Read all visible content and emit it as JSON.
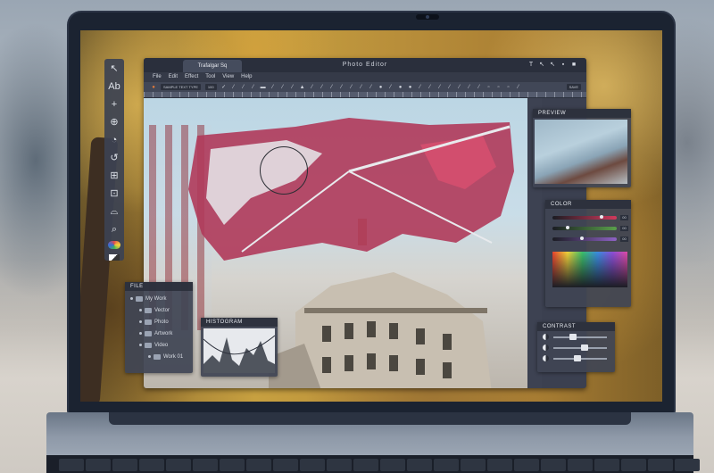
{
  "window": {
    "title": "Photo Editor",
    "document_tab": "Trafalgar Sq",
    "controls": [
      "T",
      "↖",
      "↖",
      "▪",
      "■"
    ]
  },
  "menu": [
    "File",
    "Edit",
    "Effect",
    "Tool",
    "View",
    "Help"
  ],
  "toolbar": {
    "text_box": "SAMPLE TEXT TYPE",
    "size_value": "100",
    "icons": [
      "checkmark",
      "brush",
      "brush",
      "brush",
      "rectangle",
      "pen",
      "pen",
      "pen",
      "droplet",
      "pen",
      "pen",
      "pen",
      "pen",
      "pen",
      "pen",
      "pen",
      "drop",
      "pen",
      "circle",
      "circle",
      "pen",
      "pen",
      "pen",
      "pen",
      "pen",
      "pen",
      "pen",
      "square",
      "square",
      "square",
      "pen"
    ],
    "end_badge": "SAVE"
  },
  "tools_palette": [
    "↖",
    "Ab",
    "+",
    "⊕",
    "◔",
    "↺",
    "⊞",
    "⊡",
    "⌓",
    "⌕"
  ],
  "panels": {
    "preview": {
      "title": "PREVIEW"
    },
    "color": {
      "title": "COLOR",
      "sliders": [
        {
          "color": "#d23a5c",
          "value": 0.78,
          "label": "00"
        },
        {
          "color": "#5aa04b",
          "value": 0.22,
          "label": "00"
        },
        {
          "color": "#8e62c4",
          "value": 0.45,
          "label": "00"
        }
      ]
    },
    "files": {
      "title": "FILE",
      "items": [
        {
          "label": "My Work",
          "depth": 0
        },
        {
          "label": "Vector",
          "depth": 1
        },
        {
          "label": "Photo",
          "depth": 1
        },
        {
          "label": "Artwork",
          "depth": 1
        },
        {
          "label": "Video",
          "depth": 1
        },
        {
          "label": "Work 01",
          "depth": 2
        }
      ]
    },
    "histogram": {
      "title": "HISTOGRAM"
    },
    "contrast": {
      "title": "CONTRAST",
      "sliders": [
        0.35,
        0.6,
        0.45
      ]
    }
  },
  "colors": {
    "accent": "#c0385a",
    "panel": "#404554",
    "titlebar": "#2a2f3c"
  }
}
